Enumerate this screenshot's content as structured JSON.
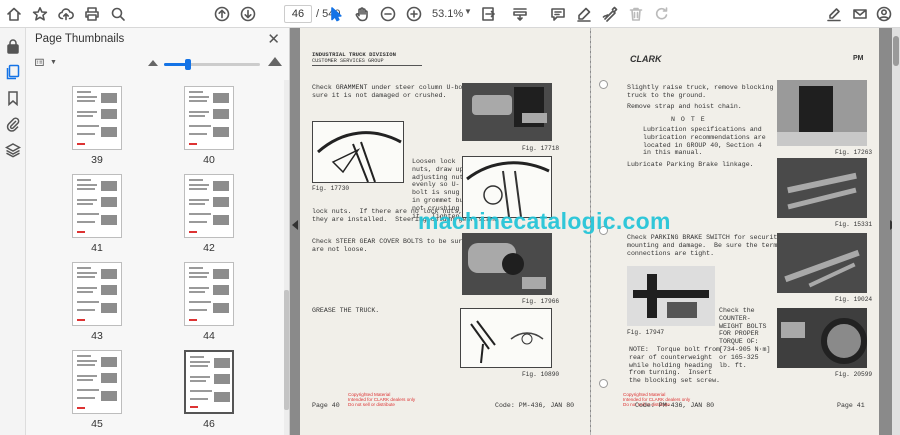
{
  "toolbar": {
    "page_current": "46",
    "page_total": "/ 540",
    "zoom": "53.1%"
  },
  "sidebar": {
    "title": "Page Thumbnails",
    "thumbnail_size_fraction": 0.25,
    "thumbnails": [
      {
        "label": "39",
        "selected": false
      },
      {
        "label": "40",
        "selected": false
      },
      {
        "label": "41",
        "selected": false
      },
      {
        "label": "42",
        "selected": false
      },
      {
        "label": "43",
        "selected": false
      },
      {
        "label": "44",
        "selected": false
      },
      {
        "label": "45",
        "selected": false
      },
      {
        "label": "46",
        "selected": true
      }
    ]
  },
  "document": {
    "watermark": "machinecatalogic.com",
    "left_page": {
      "header_line1": "INDUSTRIAL TRUCK DIVISION",
      "header_line2": "CUSTOMER SERVICES GROUP",
      "para1": "Check GRAMMENT under steer column U-bolt.  Be\nsure it is not damaged or crushed.",
      "para2": "Loosen lock\nnuts, draw up\nadjusting nuts\nevenly so U-\nbolt is snug\nin grommet but\nnot crushing\nit.  Tighten",
      "para3": "lock nuts.  If there are no lock nuts, make sure\nthey are installed.  Steering column gear stand",
      "para4": "Check STEER GEAR COVER BOLTS to be sure they\nare not loose.",
      "para5": "GREASE THE TRUCK.",
      "fig_a": "Fig. 17730",
      "fig_b": "Fig. 17718",
      "fig_c": "Fig. 17966",
      "fig_d": "Fig. 10890",
      "copyright": "Copyrighted Material\nIntended for CLARK dealers only\nDo not sell or distribute",
      "footer_page": "Page 40",
      "footer_code": "Code: PM-436, JAN 80"
    },
    "right_page": {
      "brand": "CLARK",
      "model": "PM",
      "para1": "Slightly raise truck, remove blocking and lower\ntruck to the ground.",
      "para2": "Remove strap and hoist chain.",
      "note_head": "N O T E",
      "note_body": "Lubrication specifications and\nlubrication recommendations are\nlocated in GROUP 40, Section 4\nin this manual.",
      "para3": "Lubricate Parking Brake linkage.",
      "para4": "Check PARKING BRAKE SWITCH for security of\nmounting and damage.  Be sure the terminal\nconnections are tight.",
      "side_text": "Check the\nCOUNTER-\nWEIGHT BOLTS\nFOR PROPER\nTORQUE OF:\n[734-905 N·m]\nor 165-325\nlb. ft.",
      "note2": "NOTE:  Torque bolt from\nrear of counterweight\nwhile holding heading\nfrom turning.  Insert\nthe blocking set screw.",
      "fig_a": "Fig. 17263",
      "fig_b": "Fig. 15331",
      "fig_c": "Fig. 17947",
      "fig_d": "Fig. 19024",
      "fig_e": "Fig. 20599",
      "copyright": "Copyrighted Material\nIntended for CLARK dealers only\nDo not sell or distribute",
      "footer_code": "Code: PM-436, JAN 80",
      "footer_page": "Page 41"
    }
  },
  "colors": {
    "accent": "#1473e6",
    "watermark": "#20c4d8",
    "doc_background": "#8a8a8a",
    "page_paper": "#f1efe9"
  }
}
